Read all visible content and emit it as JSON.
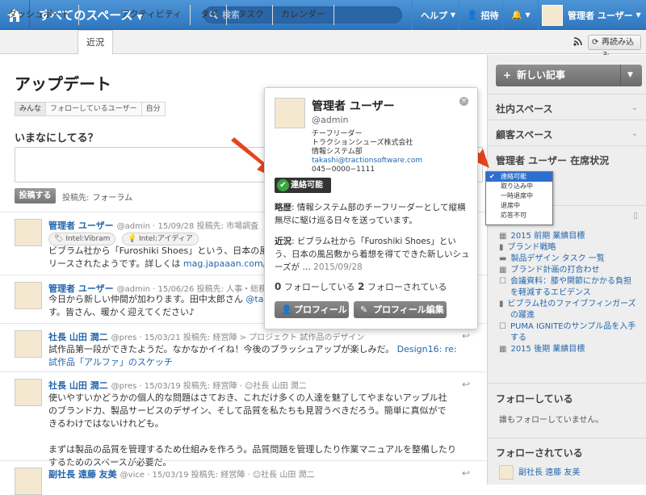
{
  "topbar": {
    "title": "すべてのスペース",
    "search_placeholder": "検索",
    "help": "ヘルプ",
    "invite": "招待",
    "user": "管理者 ユーザー"
  },
  "tabs": [
    "ダッシュボード",
    "近況",
    "アクティビティ",
    "タグ",
    "タスク",
    "カレンダー"
  ],
  "reload": "再読み込み",
  "main": {
    "heading": "アップデート",
    "subtabs": [
      "みんな",
      "フォローしているユーザー",
      "自分"
    ],
    "ask": "いまなにしてる？",
    "post_button": "投稿する",
    "post_to_label": "投稿先:",
    "post_to_value": "フォーラム"
  },
  "feed": [
    {
      "name": "管理者 ユーザー",
      "meta": "@admin · 15/09/28 投稿先: 市場調査",
      "tags": [
        "Intel:Vibram",
        "Intel:アイディア"
      ],
      "text1": "ビブラム社から「Furoshiki Shoes」という、日本の風",
      "text2": "リースされたようです。詳しくは",
      "link": "mag.japaaan.com/a"
    },
    {
      "name": "管理者 ユーザー",
      "meta": "@admin · 15/06/26 投稿先: 人事・総務",
      "text1": "今日から新しい仲間が加わります。田中太郎さん",
      "link1": "@tana",
      "text2": "す。皆さん、暖かく迎えてください♪"
    },
    {
      "name": "社長 山田 潤二",
      "meta": "@pres · 15/03/21 投稿先: 経営陣 > プロジェクト 試作品のデザイン",
      "text1": "試作品第一段ができたようだ。なかなかイイね！今後のブラッシュアップが楽しみだ。",
      "link": "Design16: re:",
      "link2": "試作品「アルファ」のスケッチ"
    },
    {
      "name": "社長 山田 潤二",
      "meta": "@pres · 15/03/19 投稿先: 経営陣 · ☺社長 山田 潤二",
      "lines": [
        "使いやすいかどうかの個人的な問題はさておき、これだけ多くの人達を魅了してやまないアップル社",
        "のブランド力、製品サービスのデザイン、そして品質を私たちも見習うべきだろう。簡単に真似がで",
        "きるわけではないけれども。",
        "",
        "まずは製品の品質を管理するため仕組みを作ろう。品質問題を管理したり作業マニュアルを整備したり",
        "するためのスペースが必要だ。"
      ]
    },
    {
      "name": "副社長 遠藤 友美",
      "meta": "@vice · 15/03/19 投稿先: 経営陣 · ☺社長 山田 潤二"
    }
  ],
  "popup": {
    "name": "管理者 ユーザー",
    "username": "@admin",
    "title": "チーフリーダー",
    "company": "トラクションシューズ株式会社",
    "dept": "情報システム部",
    "email": "takashi@tractionsoftware.com",
    "phone": "045−0000−1111",
    "status": "連絡可能",
    "bio_label": "略歴",
    "bio": ": 情報システム部のチーフリーダーとして縦横無尽に駆け巡る日々を送っています。",
    "recent_label": "近況",
    "recent": ": ビブラム社から「Furoshiki Shoes」という、日本の風呂敷から着想を得てできた新しいシューズが …",
    "recent_date": "2015/09/28",
    "following_count": "0",
    "following_label": "フォローしている",
    "followers_count": "2",
    "followers_label": "フォローされている",
    "profile_btn": "プロフィール",
    "edit_btn": "プロフィール編集"
  },
  "sidebar": {
    "new_article": "新しい記事",
    "internal_spaces": "社内スペース",
    "customer_spaces": "顧客スペース",
    "status_heading": "管理者 ユーザー 在席状況",
    "status_options": [
      "連絡可能",
      "取り込み中",
      "一時退席中",
      "退席中",
      "応答不可"
    ],
    "list_items": [
      "2015 前期 業績目標",
      "ブランド戦略",
      "製品デザイン タスク 一覧",
      "ブランド計画の打合わせ",
      "会議資料：膝や関節にかかる負担を軽減するエビデンス",
      "ビブラム社のファイブフィンガーズの躍進",
      "PUMA IGNITEのサンプル品を入手する",
      "2015 後期 業績目標"
    ],
    "following_heading": "フォローしている",
    "following_text": "誰もフォローしていません。",
    "followers_heading": "フォローされている",
    "follower_name": "副社長 遠藤 友美"
  }
}
